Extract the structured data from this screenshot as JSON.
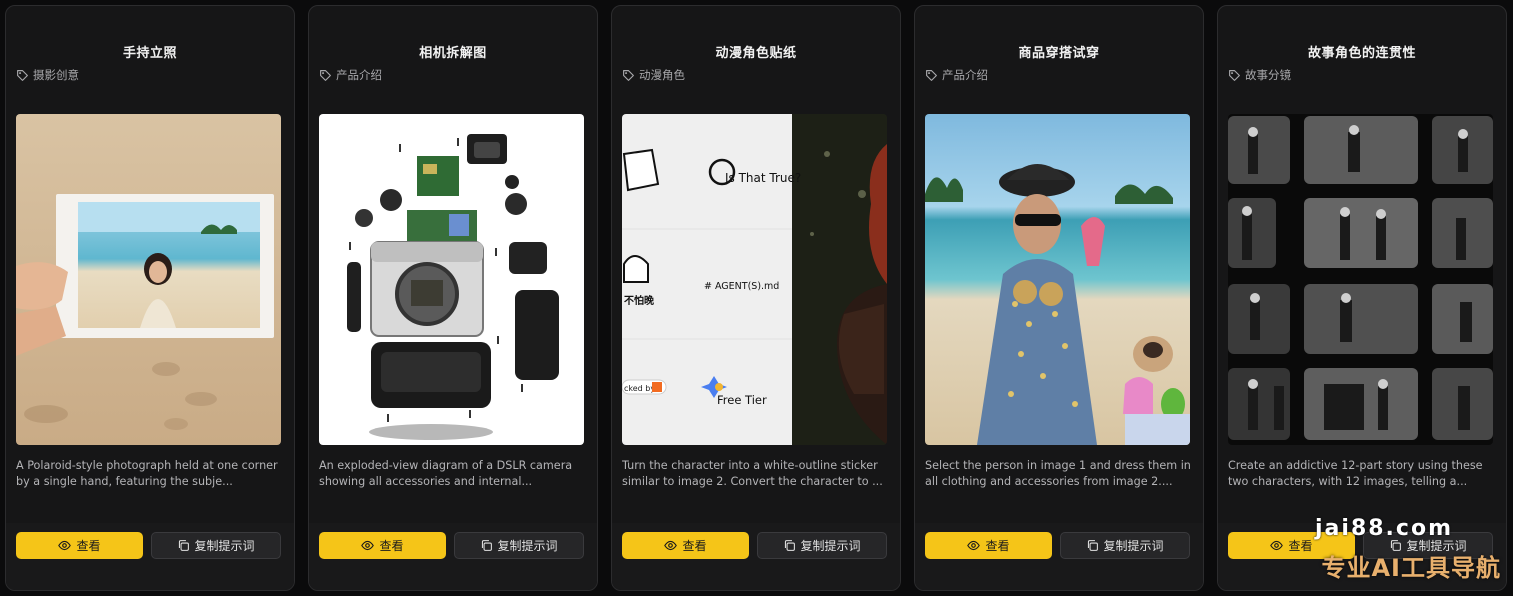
{
  "cards": [
    {
      "title": "手持立照",
      "tag": "摄影创意",
      "description": "A Polaroid-style photograph held at one corner by a single hand, featuring the subje...",
      "view_label": "查看",
      "copy_label": "复制提示词"
    },
    {
      "title": "相机拆解图",
      "tag": "产品介绍",
      "description": "An exploded-view diagram of a DSLR camera showing all accessories and internal...",
      "view_label": "查看",
      "copy_label": "复制提示词"
    },
    {
      "title": "动漫角色贴纸",
      "tag": "动漫角色",
      "description": "Turn the character into a white-outline sticker similar to image 2. Convert the character to ...",
      "view_label": "查看",
      "copy_label": "复制提示词",
      "image_text": {
        "sticker_1": "Is That True?",
        "sticker_2": "# AGENT(S).md",
        "sticker_3": "不怕晚",
        "sticker_4": "cked by",
        "sticker_5": "Free Tier"
      }
    },
    {
      "title": "商品穿搭试穿",
      "tag": "产品介绍",
      "description": "Select the person in image 1 and dress them in all clothing and accessories from image 2....",
      "view_label": "查看",
      "copy_label": "复制提示词"
    },
    {
      "title": "故事角色的连贯性",
      "tag": "故事分镜",
      "description": "Create an addictive 12-part story using these two characters, with 12 images, telling a...",
      "view_label": "查看",
      "copy_label": "复制提示词"
    }
  ],
  "watermark": {
    "url": "jai88.com",
    "slogan": "专业AI工具导航"
  },
  "colors": {
    "background": "#0b0b0c",
    "card": "#161617",
    "accent": "#f5c518",
    "watermark_slogan": "#e8b06d"
  }
}
